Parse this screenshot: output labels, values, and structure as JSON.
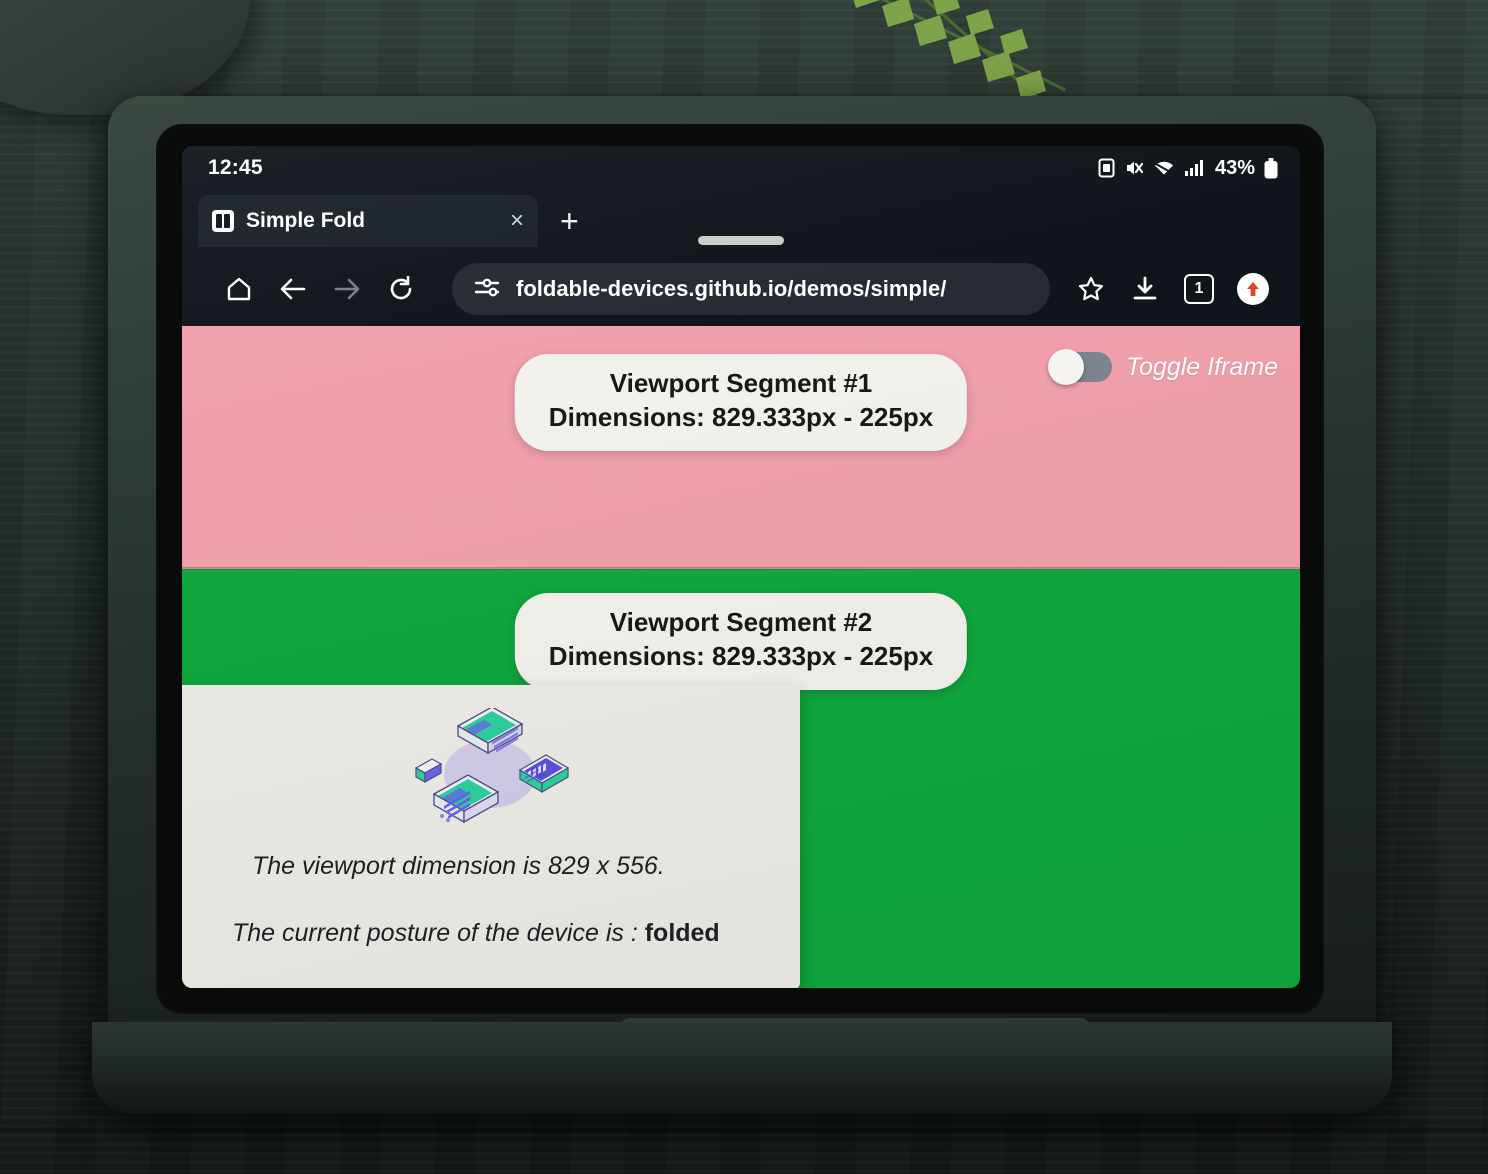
{
  "device": {
    "statusbar": {
      "time": "12:45",
      "battery_percent": "43%",
      "icons": [
        "screenshot-icon",
        "mute-icon",
        "wifi-icon",
        "signal-icon",
        "battery-icon"
      ]
    }
  },
  "browser": {
    "tab": {
      "title": "Simple Fold",
      "favicon": "foldable-favicon-icon",
      "close_label": "×",
      "new_tab_label": "+"
    },
    "toolbar": {
      "home": "home-icon",
      "back": "back-arrow-icon",
      "forward": "forward-arrow-icon",
      "reload": "reload-icon",
      "site_settings": "tune-icon",
      "url": "foldable-devices.github.io/demos/simple/",
      "bookmark": "star-icon",
      "download": "download-icon",
      "tab_count": "1",
      "menu": "profile-icon"
    }
  },
  "page": {
    "segments": [
      {
        "title": "Viewport Segment #1",
        "dimensions": "Dimensions: 829.333px - 225px",
        "color": "#f1a0ab"
      },
      {
        "title": "Viewport Segment #2",
        "dimensions": "Dimensions: 829.333px - 225px",
        "color": "#0fa83e"
      }
    ],
    "toggle": {
      "label": "Toggle Iframe",
      "state": "off"
    },
    "card": {
      "illustration": "foldable-laptops-illustration",
      "viewport_line": "The viewport dimension is 829 x 556.",
      "posture_line": "The current posture of the device is : ",
      "posture_value": "folded"
    }
  },
  "colors": {
    "segment_1": "#f1a0ab",
    "segment_2": "#0fa83e",
    "card_bg": "#edece6",
    "chrome_bg": "#10151c",
    "omnibox_bg": "#262b33"
  }
}
